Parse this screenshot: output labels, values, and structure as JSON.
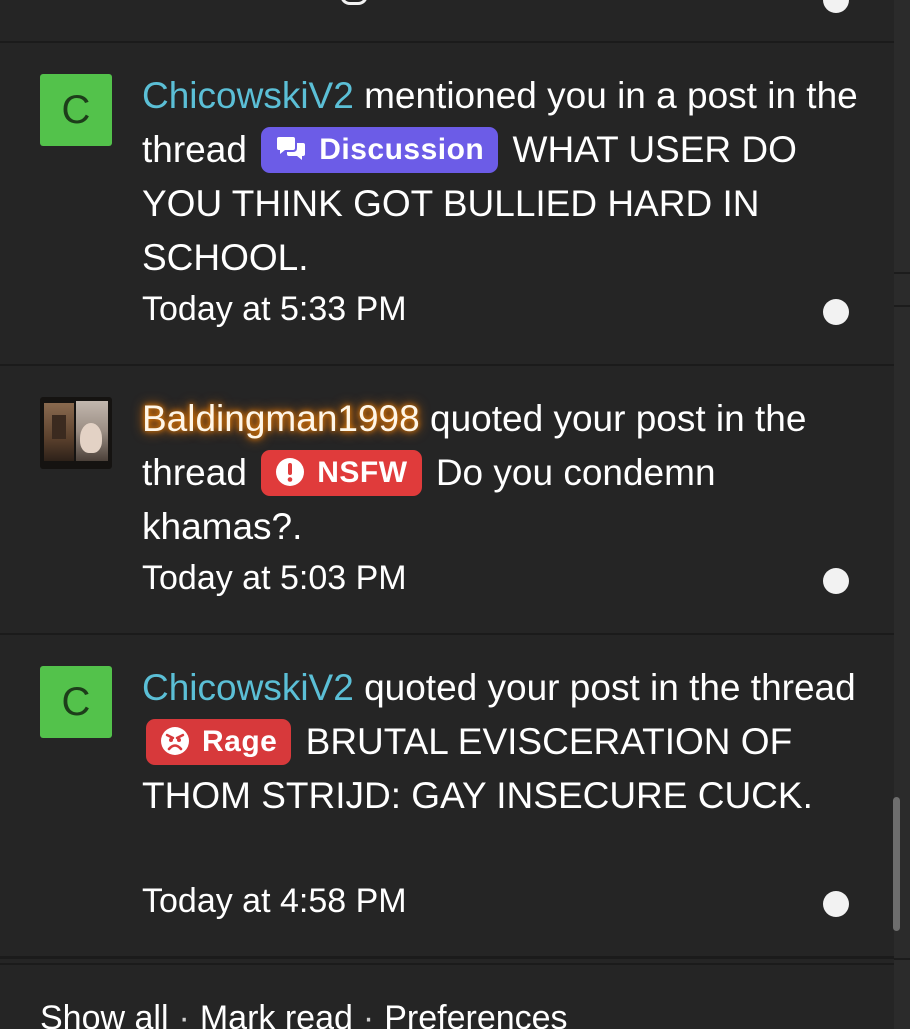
{
  "alerts": [
    {
      "username": "ChicowskiV2",
      "avatar_letter": "C",
      "action": "mentioned you in a post in the thread",
      "prefix": "Discussion",
      "prefix_icon": "chat-bubbles-icon",
      "thread_title": "WHAT USER DO YOU THINK GOT BULLIED HARD IN SCHOOL.",
      "time": "Today at 5:33 PM",
      "unread": true
    },
    {
      "username": "Baldingman1998",
      "avatar_letter": "",
      "action": "quoted your post in the thread",
      "prefix": "NSFW",
      "prefix_icon": "exclamation-circle-icon",
      "thread_title": "Do you condemn khamas?.",
      "time": "Today at 5:03 PM",
      "unread": true
    },
    {
      "username": "ChicowskiV2",
      "avatar_letter": "C",
      "action": "quoted your post in the thread",
      "prefix": "Rage",
      "prefix_icon": "angry-face-icon",
      "thread_title": "BRUTAL EVISCERATION OF THOM STRIJD: GAY INSECURE CUCK.",
      "time": "Today at 4:58 PM",
      "unread": true
    }
  ],
  "footer": {
    "show_all": "Show all",
    "mark_read": "Mark read",
    "preferences": "Preferences",
    "separator": "·"
  },
  "colors": {
    "background": "#252525",
    "username_link": "#5bbfd6",
    "prefix_discussion": "#6c5ce7",
    "prefix_nsfw": "#e03b3b",
    "prefix_rage": "#d7393b",
    "avatar_green": "#53c24b"
  }
}
